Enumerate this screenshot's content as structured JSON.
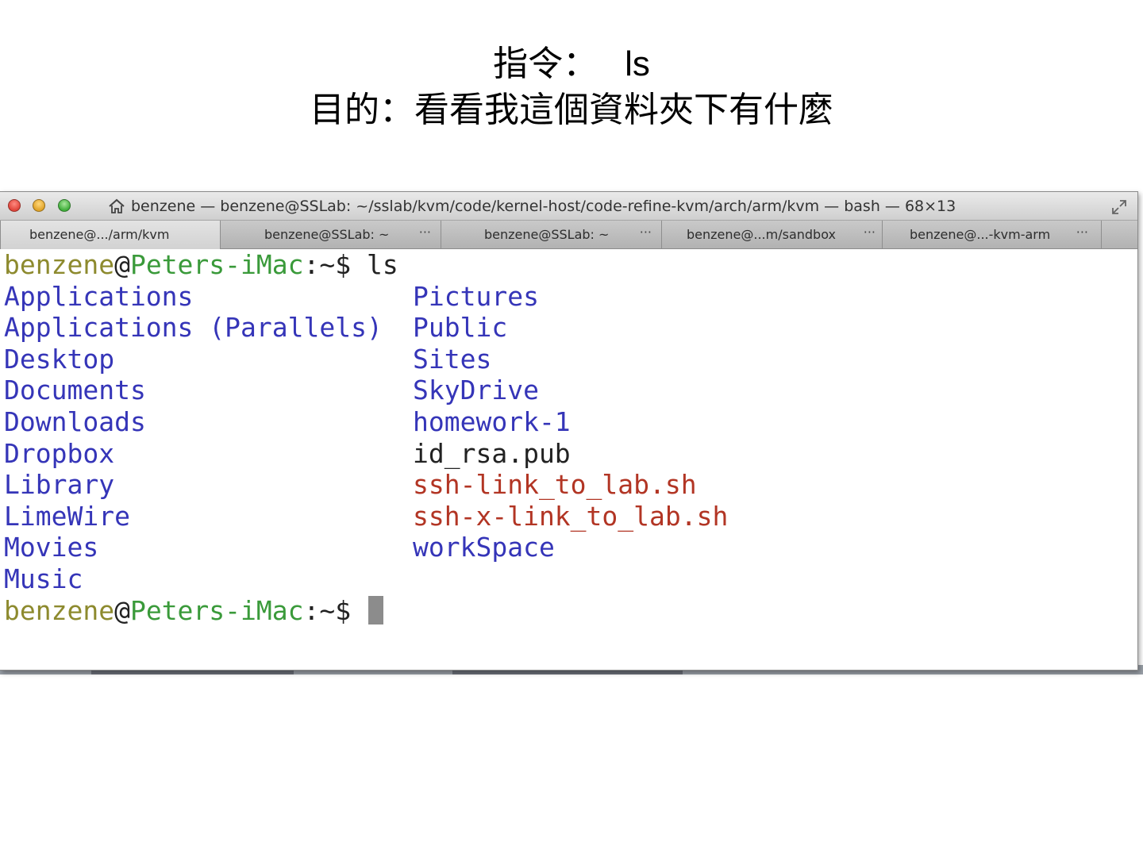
{
  "slide": {
    "line1_label": "指令：",
    "line1_command": "ls",
    "line2": "目的：看看我這個資料夾下有什麼"
  },
  "window": {
    "title": "benzene — benzene@SSLab: ~/sslab/kvm/code/kernel-host/code-refine-kvm/arch/arm/kvm — bash — 68×13"
  },
  "tabs": [
    {
      "label": "benzene@.../arm/kvm",
      "more": ""
    },
    {
      "label": "benzene@SSLab: ~",
      "more": "···"
    },
    {
      "label": "benzene@SSLab: ~",
      "more": "···"
    },
    {
      "label": "benzene@...m/sandbox",
      "more": "···"
    },
    {
      "label": "benzene@...-kvm-arm",
      "more": "···"
    }
  ],
  "prompt": {
    "user": "benzene",
    "at": "@",
    "host": "Peters-iMac",
    "path": ":~$",
    "command": "ls"
  },
  "listing": {
    "col1": [
      "Applications",
      "Applications (Parallels)",
      "Desktop",
      "Documents",
      "Downloads",
      "Dropbox",
      "Library",
      "LimeWire",
      "Movies",
      "Music"
    ],
    "col2": [
      "Pictures",
      "Public",
      "Sites",
      "SkyDrive",
      "homework-1",
      "id_rsa.pub",
      "ssh-link_to_lab.sh",
      "ssh-x-link_to_lab.sh",
      "workSpace"
    ]
  },
  "colors": {
    "directory": "#3535b8",
    "executable": "#b23524",
    "prompt_user": "#8d8a2e",
    "prompt_host": "#3a9a3a"
  }
}
